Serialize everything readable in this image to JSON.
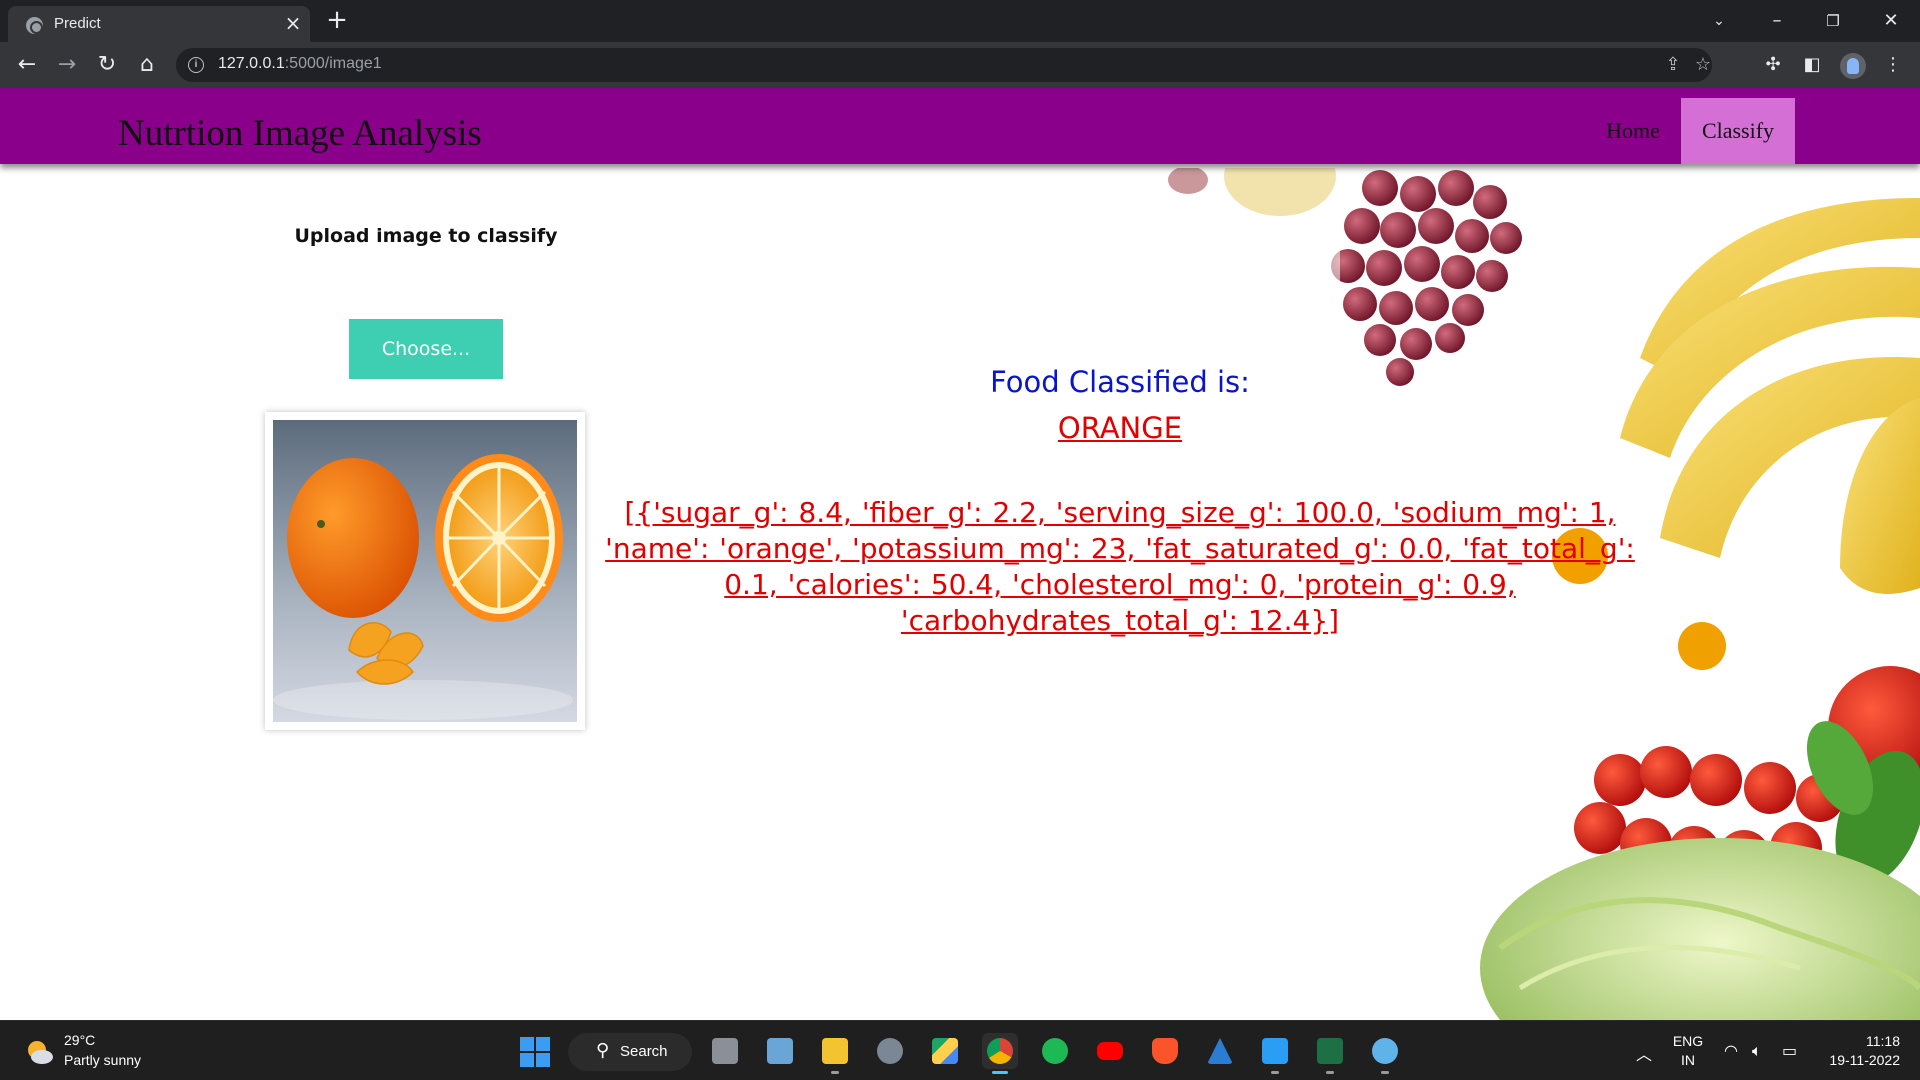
{
  "browser": {
    "tab_title": "Predict",
    "url_host": "127.0.0.1",
    "url_rest": ":5000/image1",
    "icons": [
      "globe-icon",
      "close-icon",
      "plus-icon",
      "chevron-down-icon",
      "minimize-icon",
      "restore-icon",
      "close-window-icon",
      "back-icon",
      "forward-icon",
      "reload-icon",
      "home-icon",
      "info-icon",
      "share-icon",
      "star-icon",
      "extensions-icon",
      "sidepanel-icon",
      "profile-avatar",
      "kebab-menu-icon"
    ]
  },
  "site": {
    "brand": "Nutrtion Image Analysis",
    "nav": {
      "home": "Home",
      "classify": "Classify"
    },
    "accent": "#8b008b",
    "active_nav_bg": "#d46fd6"
  },
  "upload": {
    "label": "Upload image to classify",
    "button": "Choose..."
  },
  "result": {
    "title": "Food Classified is:",
    "food": "ORANGE",
    "nutrition": "[{'sugar_g': 8.4, 'fiber_g': 2.2, 'serving_size_g': 100.0, 'sodium_mg': 1, 'name': 'orange', 'potassium_mg': 23, 'fat_saturated_g': 0.0, 'fat_total_g': 0.1, 'calories': 50.4, 'cholesterol_mg': 0, 'protein_g': 0.9, 'carbohydrates_total_g': 12.4}]",
    "title_color": "#0a14c8",
    "value_color": "#e00000"
  },
  "taskbar": {
    "weather_temp": "29°C",
    "weather_desc": "Partly sunny",
    "search_label": "Search",
    "lang_top": "ENG",
    "lang_bottom": "IN",
    "time": "11:18",
    "date": "19-11-2022"
  }
}
